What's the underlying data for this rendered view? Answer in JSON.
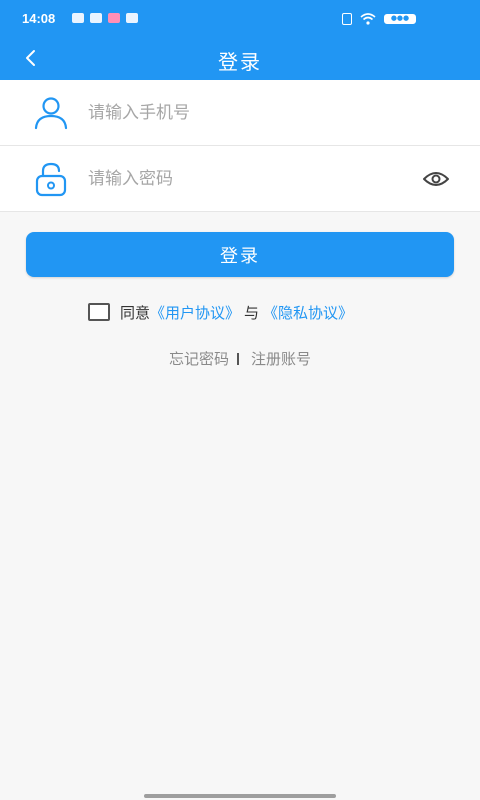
{
  "status_bar": {
    "time": "14:08",
    "battery": "●●●"
  },
  "header": {
    "title": "登录"
  },
  "form": {
    "phone_placeholder": "请输入手机号",
    "password_placeholder": "请输入密码"
  },
  "actions": {
    "login_label": "登录"
  },
  "agreement": {
    "prefix": "同意",
    "user_agreement": "《用户协议》",
    "conjunction": "与",
    "privacy_agreement": "《隐私协议》"
  },
  "links": {
    "forgot_password": "忘记密码",
    "register": "注册账号"
  },
  "colors": {
    "primary": "#2196f3",
    "background": "#f7f7f7"
  },
  "icons": {
    "user": "user-icon",
    "lock": "lock-icon",
    "eye": "eye-icon",
    "back": "back-chevron-icon"
  }
}
